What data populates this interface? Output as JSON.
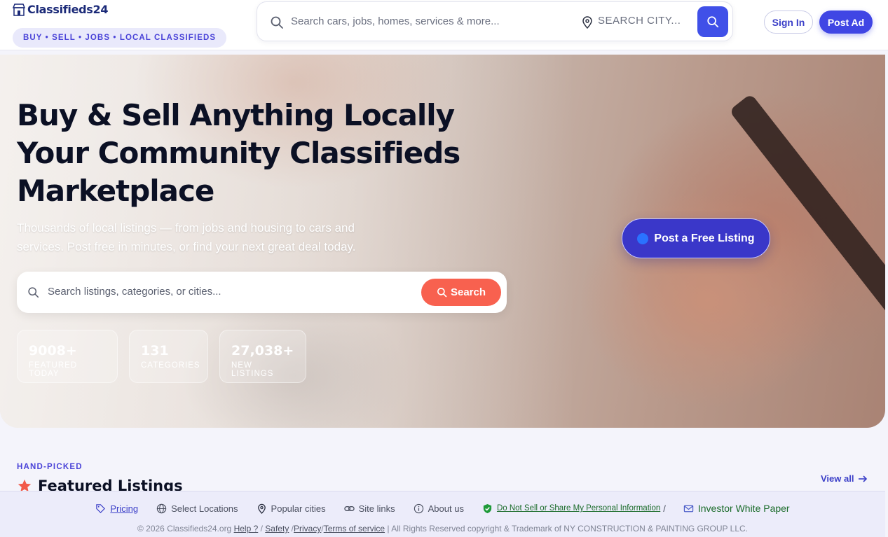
{
  "brand": {
    "name": "Classifieds24",
    "tagline": "BUY • SELL • JOBS • LOCAL CLASSIFIEDS"
  },
  "top_search": {
    "placeholder": "Search cars, jobs, homes, services & more...",
    "city_placeholder": "SEARCH CITY..."
  },
  "auth": {
    "sign_in": "Sign In",
    "post_ad": "Post Ad"
  },
  "hero": {
    "title_lines": [
      "Buy & Sell Anything Locally",
      "Your Community Classifieds",
      "Marketplace"
    ],
    "subtitle": "Thousands of local listings — from jobs and housing to cars and services. Post free in minutes, or find your next great deal today.",
    "search_placeholder": "Search listings, categories, or cities...",
    "search_button": "Search",
    "cta": "Post a Free Listing",
    "stats": [
      {
        "value": "9008+",
        "label": "FEATURED TODAY"
      },
      {
        "value": "131",
        "label": "CATEGORIES"
      },
      {
        "value": "27,038+",
        "label": "NEW LISTINGS"
      }
    ]
  },
  "featured": {
    "eyebrow": "HAND-PICKED",
    "title": "Featured Listings",
    "view_all": "View all"
  },
  "footer": {
    "links": {
      "pricing": "Pricing",
      "locations": "Select Locations",
      "cities": "Popular cities",
      "site_links": "Site links",
      "about": "About us",
      "dns": "Do Not Sell or Share My Personal Information",
      "dns_sep": "/",
      "investor": "Investor White Paper"
    },
    "copyright_prefix": "© 2026 Classifieds24.org",
    "help": "Help ?",
    "sep1": "/",
    "safety": "Safety",
    "sep2": "/",
    "privacy": "Privacy",
    "sep3": "/",
    "terms": "Terms of service",
    "rights": "| All Rights Reserved copyright & Trademark of NY CONSTRUCTION & PAINTING GROUP LLC."
  },
  "colors": {
    "accent": "#4046e4",
    "search_button": "#f8614f",
    "cta": "#3a37c9",
    "ink": "#0b1024"
  }
}
